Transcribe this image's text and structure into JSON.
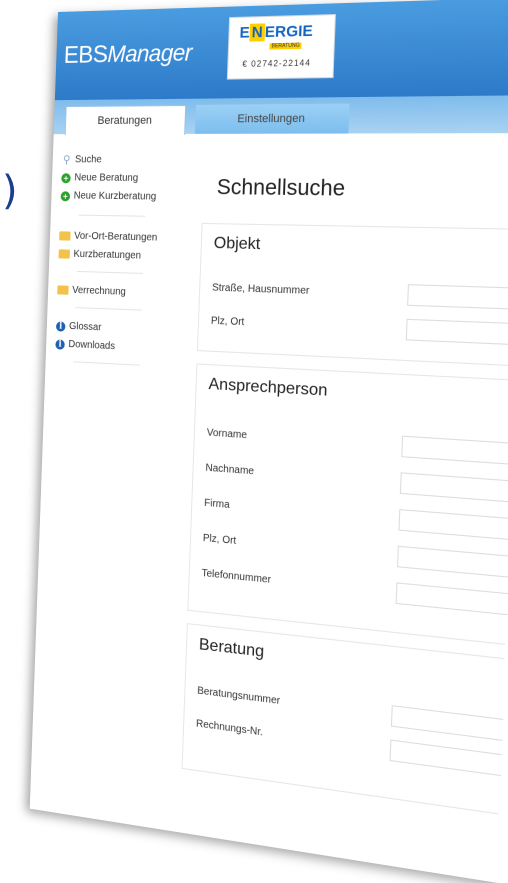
{
  "stray_char": ")",
  "header": {
    "brand": "EBS",
    "brand_suffix": "Manager",
    "logo": {
      "word_start": "E",
      "word_mid": "N",
      "word_end": "ERGIE",
      "subtitle": "BERATUNG",
      "phone": "€ 02742-22144"
    }
  },
  "tabs": [
    {
      "label": "Beratungen"
    },
    {
      "label": "Einstellungen"
    }
  ],
  "sidebar": {
    "items": [
      {
        "label": "Suche",
        "icon": "search-icon"
      },
      {
        "label": "Neue Beratung",
        "icon": "plus-icon"
      },
      {
        "label": "Neue Kurzberatung",
        "icon": "plus-icon"
      },
      {
        "label": "Vor-Ort-Beratungen",
        "icon": "folder-icon"
      },
      {
        "label": "Kurzberatungen",
        "icon": "folder-icon"
      },
      {
        "label": "Verrechnung",
        "icon": "folder-icon"
      },
      {
        "label": "Glossar",
        "icon": "info-icon"
      },
      {
        "label": "Downloads",
        "icon": "info-icon"
      }
    ]
  },
  "main": {
    "title": "Schnellsuche",
    "objekt": {
      "title": "Objekt",
      "fields": [
        "Straße, Hausnummer",
        "Plz, Ort"
      ]
    },
    "ansprechperson": {
      "title": "Ansprechperson",
      "fields": [
        "Vorname",
        "Nachname",
        "Firma",
        "Plz, Ort",
        "Telefonnummer"
      ]
    },
    "beratung": {
      "title": "Beratung",
      "fields": [
        "Beratungsnummer",
        "Rechnungs-Nr."
      ]
    }
  },
  "colors": {
    "header": "#2d7ac8",
    "tabbar": "#a9d2f2",
    "plus_icon": "#2aa12a",
    "info_icon": "#1e5fb3",
    "folder_icon": "#f2c24a"
  }
}
